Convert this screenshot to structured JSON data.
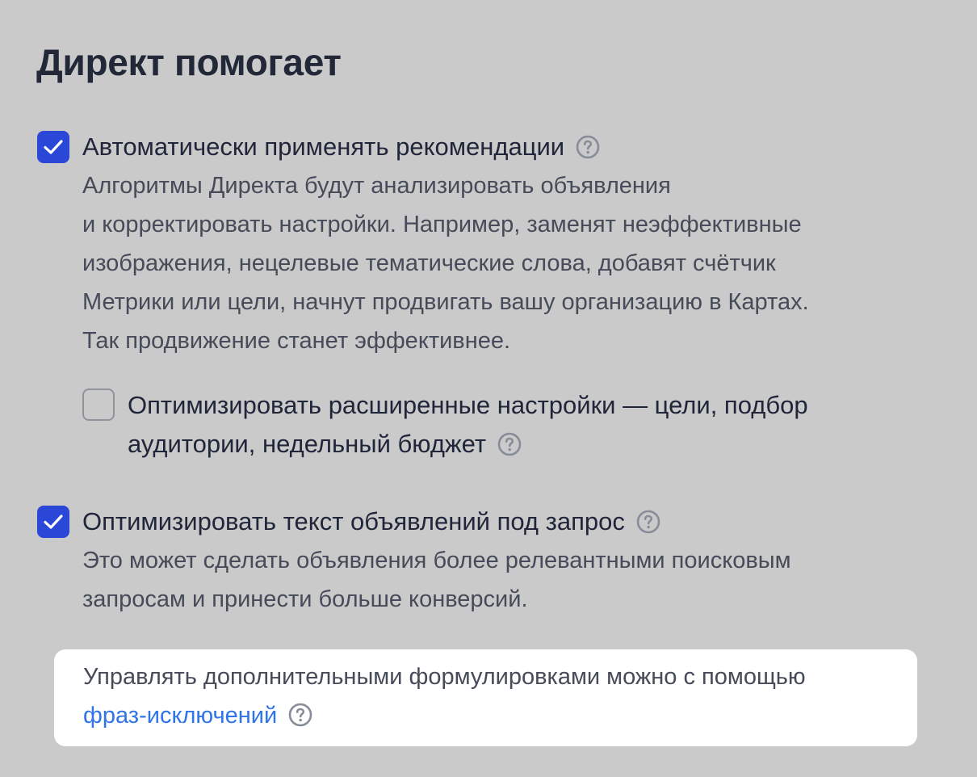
{
  "title": "Директ помогает",
  "options": {
    "auto_apply": {
      "checked": true,
      "label": "Автоматически применять рекомендации",
      "description_lines": [
        "Алгоритмы Директа будут анализировать объявления",
        "и корректировать настройки. Например, заменят неэффективные",
        "изображения, нецелевые тематические слова, добавят счётчик",
        "Метрики или цели, начнут продвигать вашу организацию в Картах.",
        "Так продвижение станет эффективнее."
      ]
    },
    "advanced": {
      "checked": false,
      "label_lines": [
        "Оптимизировать расширенные настройки — цели, подбор",
        "аудитории, недельный бюджет"
      ]
    },
    "optimize_text": {
      "checked": true,
      "label": "Оптимизировать текст объявлений под запрос",
      "description_lines": [
        "Это может сделать объявления более релевантными поисковым",
        "запросам и принести больше конверсий."
      ]
    }
  },
  "info_card": {
    "text": "Управлять дополнительными формулировками можно с помощью",
    "link_text": "фраз-исключений"
  },
  "icons": {
    "help": "question-circle-icon",
    "check": "checkmark-icon"
  },
  "colors": {
    "background": "#cacaca",
    "checkbox_checked": "#2b47d8",
    "link": "#2f74e8",
    "help_icon": "#878c99",
    "card": "#ffffff"
  }
}
